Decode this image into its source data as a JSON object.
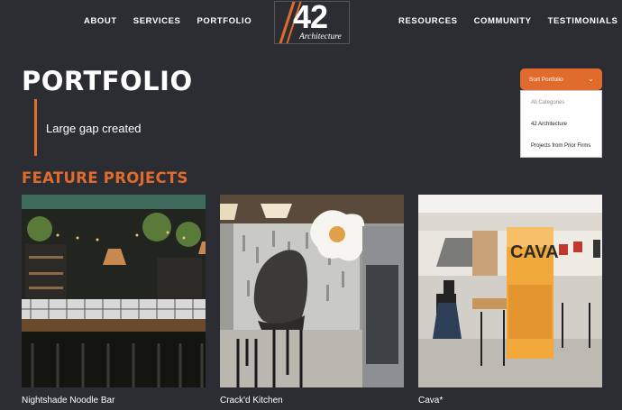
{
  "nav": {
    "left": [
      "ABOUT",
      "SERVICES",
      "PORTFOLIO"
    ],
    "right": [
      "RESOURCES",
      "COMMUNITY",
      "TESTIMONIALS"
    ]
  },
  "logo": {
    "number": "42",
    "text": "Architecture"
  },
  "page": {
    "title": "PORTFOLIO",
    "quote": "Large gap created"
  },
  "sort": {
    "label": "Sort Portfolio",
    "options": [
      "All Categories",
      "42 Architecture",
      "Projects from Prior Firms"
    ]
  },
  "section": {
    "title": "FEATURE PROJECTS"
  },
  "projects": [
    {
      "caption": "Nightshade Noodle Bar"
    },
    {
      "caption": "Crack'd Kitchen"
    },
    {
      "caption": "Cava*"
    }
  ],
  "colors": {
    "background": "#2b2d33",
    "accent": "#e06b2d"
  }
}
